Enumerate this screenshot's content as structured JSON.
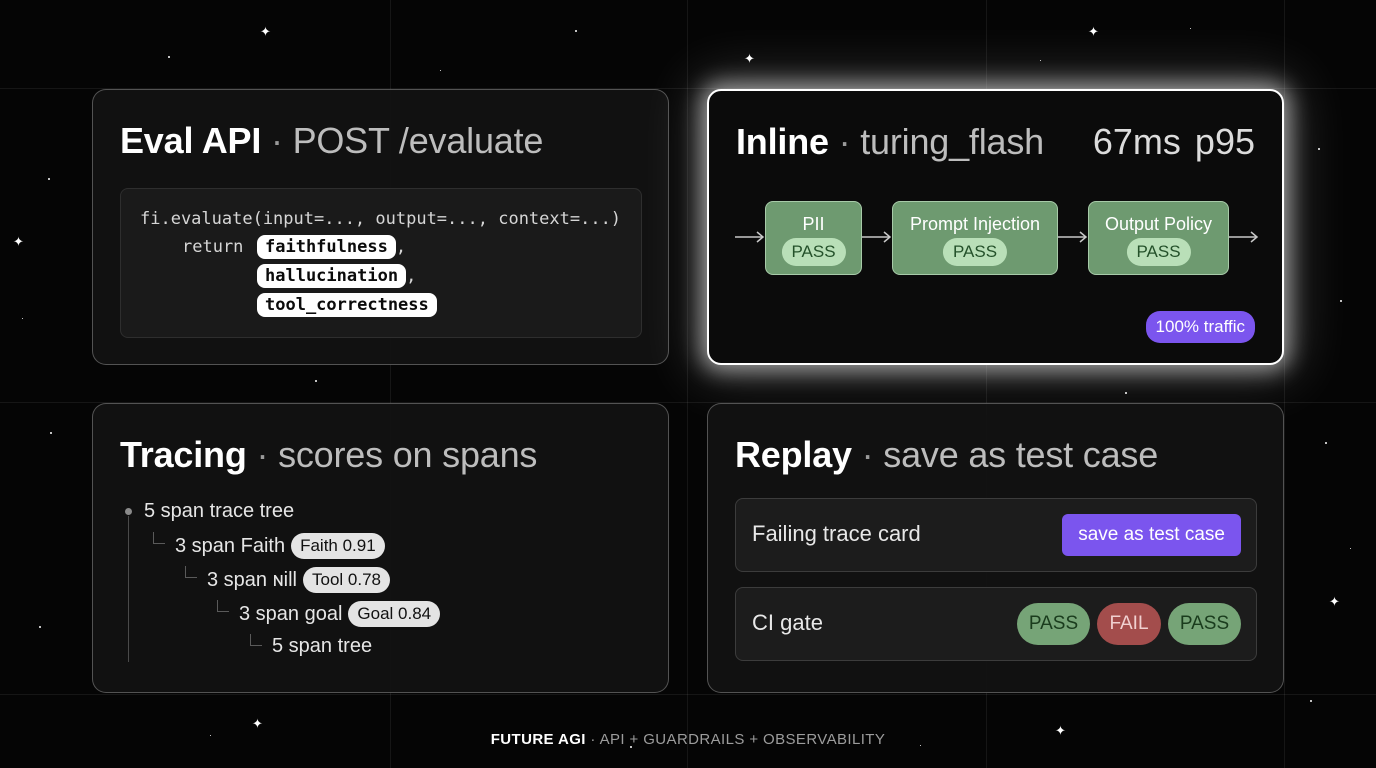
{
  "eval_api": {
    "title": "Eval API",
    "subtitle": "POST /evaluate",
    "code_line1": "fi.evaluate(input=..., output=..., context=...)",
    "code_return": "return",
    "metrics": [
      "faithfulness",
      "hallucination",
      "tool_correctness"
    ]
  },
  "inline": {
    "title": "Inline",
    "subtitle": "turing_flash",
    "latency_value": "67ms",
    "latency_stat": "p95",
    "stages": [
      {
        "name": "PII",
        "status": "PASS"
      },
      {
        "name": "Prompt Injection",
        "status": "PASS"
      },
      {
        "name": "Output Policy",
        "status": "PASS"
      }
    ],
    "traffic": "100% traffic"
  },
  "tracing": {
    "title": "Tracing",
    "subtitle": "scores on spans",
    "nodes": [
      {
        "label": "5 span trace tree",
        "score": ""
      },
      {
        "label": "3 span Faith",
        "score": "Faith 0.91"
      },
      {
        "label": "3 span ɴill",
        "score": "Tool 0.78"
      },
      {
        "label": "3 span goal",
        "score": "Goal 0.84"
      },
      {
        "label": "5 span tree",
        "score": ""
      }
    ]
  },
  "replay": {
    "title": "Replay",
    "subtitle": "save as test case",
    "failing_label": "Failing trace card",
    "save_button": "save as test case",
    "ci_label": "CI gate",
    "ci_results": [
      "PASS",
      "FAIL",
      "PASS"
    ]
  },
  "footer": {
    "brand": "FUTURE AGI",
    "tagline": "API + GUARDRAILS + OBSERVABILITY"
  },
  "colors": {
    "accent_purple": "#7b55ee",
    "pass_green": "#76a477",
    "fail_red": "#a34d4c",
    "background": "#050505"
  }
}
